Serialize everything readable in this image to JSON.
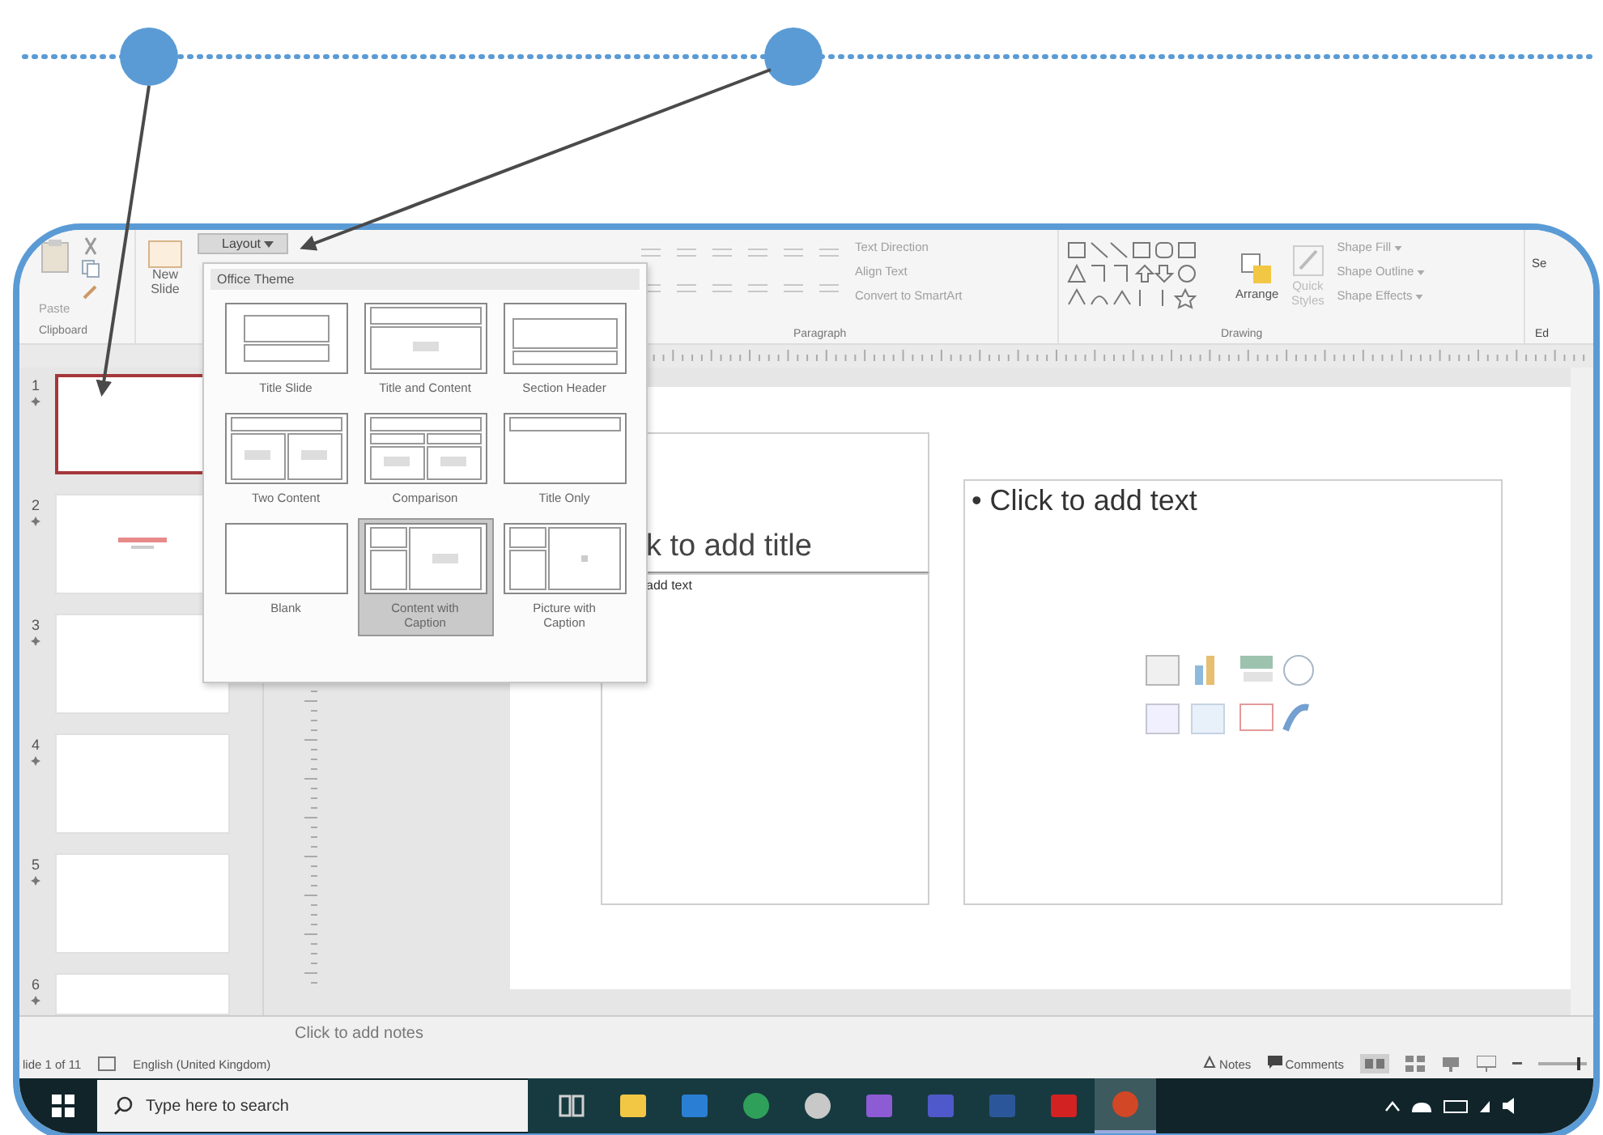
{
  "ribbon": {
    "clipboard": {
      "paste": "Paste",
      "label": "Clipboard"
    },
    "new_slide": "New Slide",
    "layout_button": "Layout",
    "paragraph": {
      "commands": [
        "Text Direction",
        "Align Text",
        "Convert to SmartArt"
      ],
      "label": "Paragraph"
    },
    "drawing": {
      "arrange": "Arrange",
      "quick_styles": "Quick Styles",
      "commands": [
        "Shape Fill",
        "Shape Outline",
        "Shape Effects"
      ],
      "label": "Drawing"
    },
    "editing": {
      "command": "Se",
      "label": "Ed"
    }
  },
  "layout_menu": {
    "header": "Office Theme",
    "layouts": [
      {
        "name": "Title Slide",
        "kind": "title",
        "selected": false
      },
      {
        "name": "Title and Content",
        "kind": "title-content",
        "selected": false
      },
      {
        "name": "Section Header",
        "kind": "section",
        "selected": false
      },
      {
        "name": "Two Content",
        "kind": "two-content",
        "selected": false
      },
      {
        "name": "Comparison",
        "kind": "comparison",
        "selected": false
      },
      {
        "name": "Title Only",
        "kind": "title-only",
        "selected": false
      },
      {
        "name": "Blank",
        "kind": "blank",
        "selected": false
      },
      {
        "name": "Content with Caption",
        "kind": "content-caption",
        "selected": true
      },
      {
        "name": "Picture with Caption",
        "kind": "picture-caption",
        "selected": false
      }
    ]
  },
  "slides": [
    {
      "number": "1",
      "kind": "blank",
      "selected": true
    },
    {
      "number": "2",
      "kind": "title",
      "selected": false
    },
    {
      "number": "3",
      "kind": "blank",
      "selected": false
    },
    {
      "number": "4",
      "kind": "blank",
      "selected": false
    },
    {
      "number": "5",
      "kind": "blank",
      "selected": false
    },
    {
      "number": "6",
      "kind": "blank",
      "selected": false
    }
  ],
  "slide": {
    "title": "k to add title",
    "caption": "add text",
    "content": "• Click to add text"
  },
  "notes": {
    "placeholder": "Click to add notes"
  },
  "status_bar": {
    "slide_count": "lide 1 of 11",
    "language": "English (United Kingdom)",
    "notes": "Notes",
    "comments": "Comments",
    "zoom_slider": {
      "level": 0.85
    }
  },
  "taskbar": {
    "search": {
      "placeholder": "Type here to search"
    },
    "apps": [
      {
        "kind": "task-view",
        "selected": false
      },
      {
        "kind": "folder",
        "selected": false
      },
      {
        "kind": "mail",
        "selected": false
      },
      {
        "kind": "browser",
        "selected": false
      },
      {
        "kind": "cloud",
        "selected": false
      },
      {
        "kind": "chat",
        "selected": false
      },
      {
        "kind": "teams",
        "selected": false
      },
      {
        "kind": "word",
        "selected": false
      },
      {
        "kind": "pdf",
        "selected": false
      },
      {
        "kind": "slides",
        "selected": true
      }
    ]
  }
}
